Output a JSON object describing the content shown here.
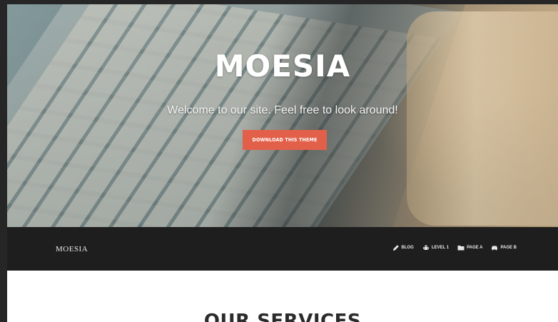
{
  "hero": {
    "title": "MOESIA",
    "subtitle": "Welcome to our site. Feel free to look around!",
    "button_label": "Download this theme"
  },
  "navbar": {
    "brand": "MOESIA",
    "items": [
      {
        "label": "Blog",
        "icon": "pencil-icon"
      },
      {
        "label": "Level 1",
        "icon": "android-icon"
      },
      {
        "label": "Page A",
        "icon": "folder-icon"
      },
      {
        "label": "Page B",
        "icon": "car-icon"
      }
    ]
  },
  "content": {
    "section_title": "OUR SERVICES"
  },
  "colors": {
    "accent": "#e2604a",
    "navbar_bg": "#1e1e1e"
  }
}
